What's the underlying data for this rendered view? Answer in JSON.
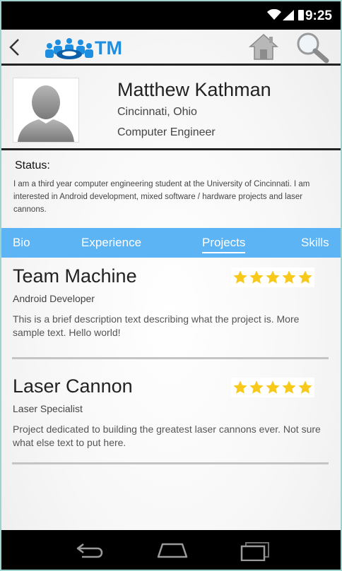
{
  "status_bar": {
    "time": "9:25"
  },
  "app_bar": {
    "logo_text": "TM"
  },
  "profile": {
    "name": "Matthew Kathman",
    "location": "Cincinnati, Ohio",
    "occupation": "Computer Engineer"
  },
  "status": {
    "label": "Status:",
    "text": "I am a third year computer engineering student at the University of Cincinnati. I am interested in Android development, mixed software / hardware projects and laser cannons."
  },
  "tabs": [
    {
      "label": "Bio",
      "active": false
    },
    {
      "label": "Experience",
      "active": false
    },
    {
      "label": "Projects",
      "active": true
    },
    {
      "label": "Skills",
      "active": false
    }
  ],
  "projects": [
    {
      "title": "Team Machine",
      "role": "Android Developer",
      "description": "This is a brief description text describing what the project is. More sample text. Hello world!",
      "rating": 5
    },
    {
      "title": "Laser Cannon",
      "role": "Laser Specialist",
      "description": "Project dedicated to building the greatest laser cannons ever. Not sure what else text to put here.",
      "rating": 5
    }
  ],
  "colors": {
    "tab_bar": "#5cb4f5",
    "star": "#f7c91a",
    "logo": "#1e8ee0"
  }
}
